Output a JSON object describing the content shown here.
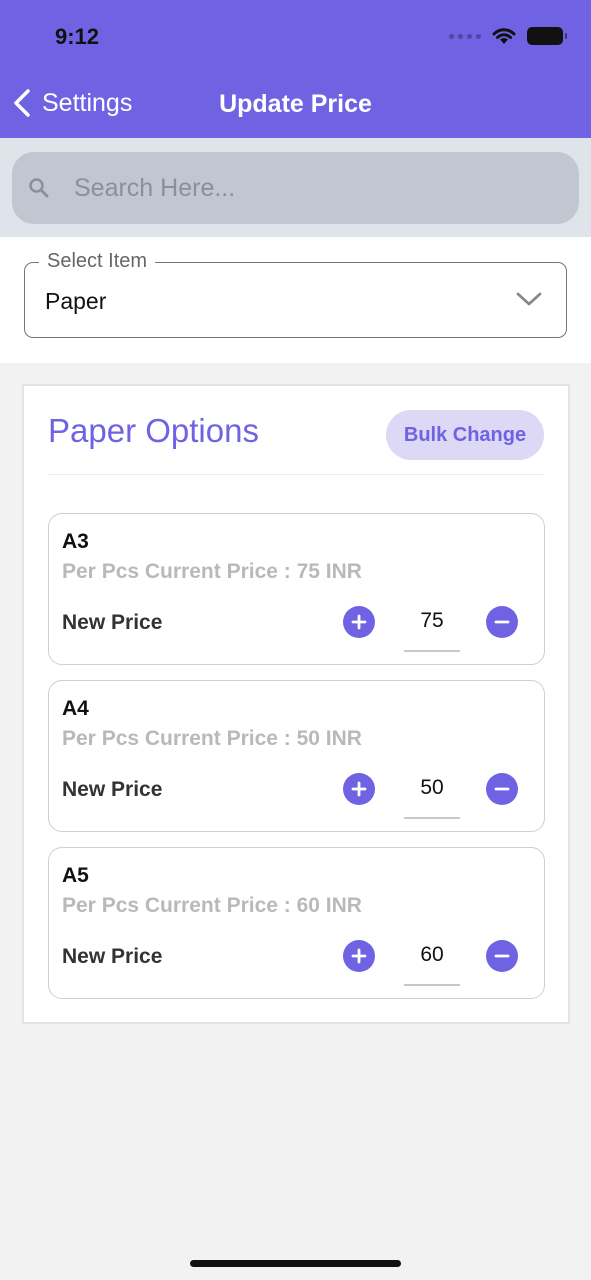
{
  "status_bar": {
    "time": "9:12"
  },
  "nav": {
    "back_label": "Settings",
    "title": "Update Price"
  },
  "search": {
    "placeholder": "Search Here..."
  },
  "select_item": {
    "label": "Select Item",
    "value": "Paper"
  },
  "panel": {
    "title": "Paper Options",
    "bulk_label": "Bulk Change",
    "items": [
      {
        "name": "A3",
        "current": "Per Pcs Current Price : 75 INR",
        "new_label": "New Price",
        "value": "75"
      },
      {
        "name": "A4",
        "current": "Per Pcs Current Price : 50 INR",
        "new_label": "New Price",
        "value": "50"
      },
      {
        "name": "A5",
        "current": "Per Pcs Current Price : 60 INR",
        "new_label": "New Price",
        "value": "60"
      }
    ]
  },
  "colors": {
    "accent": "#6f63e3",
    "accent_light": "#dcd8f5",
    "muted": "#b9b9b9"
  }
}
